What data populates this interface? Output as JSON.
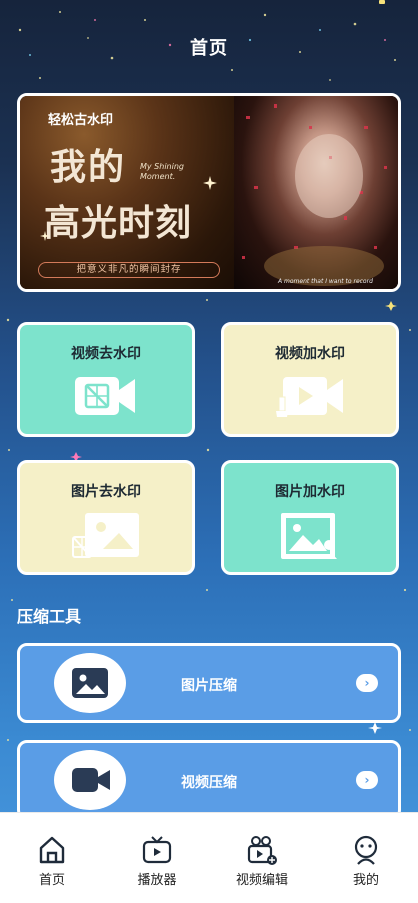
{
  "header": {
    "title": "首页"
  },
  "banner": {
    "brand": "轻松古水印",
    "headline_line1": "我的",
    "headline_line2": "高光时刻",
    "english_line1": "My Shining",
    "english_line2": "Moment.",
    "tagline": "把意义非凡的瞬间封存",
    "photo_caption": "A moment that I want to record"
  },
  "features": [
    {
      "label": "视频去水印",
      "icon": "video-remove-watermark-icon"
    },
    {
      "label": "视频加水印",
      "icon": "video-add-watermark-icon"
    },
    {
      "label": "图片去水印",
      "icon": "image-remove-watermark-icon"
    },
    {
      "label": "图片加水印",
      "icon": "image-add-watermark-icon"
    }
  ],
  "compression": {
    "section_title": "压缩工具",
    "items": [
      {
        "label": "图片压缩",
        "icon": "image-icon"
      },
      {
        "label": "视频压缩",
        "icon": "video-camera-icon"
      }
    ]
  },
  "bottom_nav": [
    {
      "label": "首页",
      "icon": "home-icon",
      "active": true
    },
    {
      "label": "播放器",
      "icon": "tv-player-icon",
      "active": false
    },
    {
      "label": "视频编辑",
      "icon": "video-edit-icon",
      "active": false
    },
    {
      "label": "我的",
      "icon": "profile-icon",
      "active": false
    }
  ],
  "colors": {
    "card_mint": "#7de3cc",
    "card_cream": "#f5f0c8",
    "compress_blue": "#5a9de6",
    "icon_white": "#ffffff"
  }
}
